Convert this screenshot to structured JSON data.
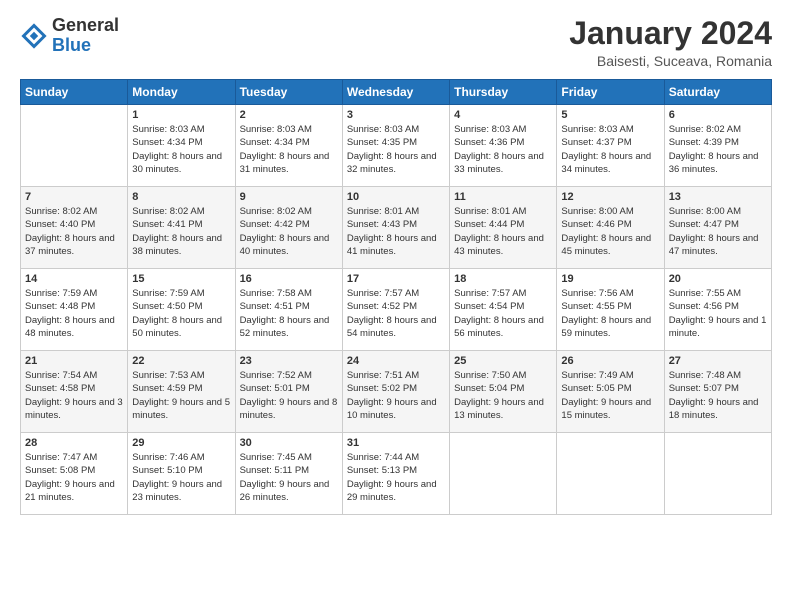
{
  "header": {
    "logo_general": "General",
    "logo_blue": "Blue",
    "month_title": "January 2024",
    "subtitle": "Baisesti, Suceava, Romania"
  },
  "weekdays": [
    "Sunday",
    "Monday",
    "Tuesday",
    "Wednesday",
    "Thursday",
    "Friday",
    "Saturday"
  ],
  "weeks": [
    [
      {
        "day": "",
        "sunrise": "",
        "sunset": "",
        "daylight": "",
        "empty": true
      },
      {
        "day": "1",
        "sunrise": "Sunrise: 8:03 AM",
        "sunset": "Sunset: 4:34 PM",
        "daylight": "Daylight: 8 hours and 30 minutes."
      },
      {
        "day": "2",
        "sunrise": "Sunrise: 8:03 AM",
        "sunset": "Sunset: 4:34 PM",
        "daylight": "Daylight: 8 hours and 31 minutes."
      },
      {
        "day": "3",
        "sunrise": "Sunrise: 8:03 AM",
        "sunset": "Sunset: 4:35 PM",
        "daylight": "Daylight: 8 hours and 32 minutes."
      },
      {
        "day": "4",
        "sunrise": "Sunrise: 8:03 AM",
        "sunset": "Sunset: 4:36 PM",
        "daylight": "Daylight: 8 hours and 33 minutes."
      },
      {
        "day": "5",
        "sunrise": "Sunrise: 8:03 AM",
        "sunset": "Sunset: 4:37 PM",
        "daylight": "Daylight: 8 hours and 34 minutes."
      },
      {
        "day": "6",
        "sunrise": "Sunrise: 8:02 AM",
        "sunset": "Sunset: 4:39 PM",
        "daylight": "Daylight: 8 hours and 36 minutes."
      }
    ],
    [
      {
        "day": "7",
        "sunrise": "Sunrise: 8:02 AM",
        "sunset": "Sunset: 4:40 PM",
        "daylight": "Daylight: 8 hours and 37 minutes."
      },
      {
        "day": "8",
        "sunrise": "Sunrise: 8:02 AM",
        "sunset": "Sunset: 4:41 PM",
        "daylight": "Daylight: 8 hours and 38 minutes."
      },
      {
        "day": "9",
        "sunrise": "Sunrise: 8:02 AM",
        "sunset": "Sunset: 4:42 PM",
        "daylight": "Daylight: 8 hours and 40 minutes."
      },
      {
        "day": "10",
        "sunrise": "Sunrise: 8:01 AM",
        "sunset": "Sunset: 4:43 PM",
        "daylight": "Daylight: 8 hours and 41 minutes."
      },
      {
        "day": "11",
        "sunrise": "Sunrise: 8:01 AM",
        "sunset": "Sunset: 4:44 PM",
        "daylight": "Daylight: 8 hours and 43 minutes."
      },
      {
        "day": "12",
        "sunrise": "Sunrise: 8:00 AM",
        "sunset": "Sunset: 4:46 PM",
        "daylight": "Daylight: 8 hours and 45 minutes."
      },
      {
        "day": "13",
        "sunrise": "Sunrise: 8:00 AM",
        "sunset": "Sunset: 4:47 PM",
        "daylight": "Daylight: 8 hours and 47 minutes."
      }
    ],
    [
      {
        "day": "14",
        "sunrise": "Sunrise: 7:59 AM",
        "sunset": "Sunset: 4:48 PM",
        "daylight": "Daylight: 8 hours and 48 minutes."
      },
      {
        "day": "15",
        "sunrise": "Sunrise: 7:59 AM",
        "sunset": "Sunset: 4:50 PM",
        "daylight": "Daylight: 8 hours and 50 minutes."
      },
      {
        "day": "16",
        "sunrise": "Sunrise: 7:58 AM",
        "sunset": "Sunset: 4:51 PM",
        "daylight": "Daylight: 8 hours and 52 minutes."
      },
      {
        "day": "17",
        "sunrise": "Sunrise: 7:57 AM",
        "sunset": "Sunset: 4:52 PM",
        "daylight": "Daylight: 8 hours and 54 minutes."
      },
      {
        "day": "18",
        "sunrise": "Sunrise: 7:57 AM",
        "sunset": "Sunset: 4:54 PM",
        "daylight": "Daylight: 8 hours and 56 minutes."
      },
      {
        "day": "19",
        "sunrise": "Sunrise: 7:56 AM",
        "sunset": "Sunset: 4:55 PM",
        "daylight": "Daylight: 8 hours and 59 minutes."
      },
      {
        "day": "20",
        "sunrise": "Sunrise: 7:55 AM",
        "sunset": "Sunset: 4:56 PM",
        "daylight": "Daylight: 9 hours and 1 minute."
      }
    ],
    [
      {
        "day": "21",
        "sunrise": "Sunrise: 7:54 AM",
        "sunset": "Sunset: 4:58 PM",
        "daylight": "Daylight: 9 hours and 3 minutes."
      },
      {
        "day": "22",
        "sunrise": "Sunrise: 7:53 AM",
        "sunset": "Sunset: 4:59 PM",
        "daylight": "Daylight: 9 hours and 5 minutes."
      },
      {
        "day": "23",
        "sunrise": "Sunrise: 7:52 AM",
        "sunset": "Sunset: 5:01 PM",
        "daylight": "Daylight: 9 hours and 8 minutes."
      },
      {
        "day": "24",
        "sunrise": "Sunrise: 7:51 AM",
        "sunset": "Sunset: 5:02 PM",
        "daylight": "Daylight: 9 hours and 10 minutes."
      },
      {
        "day": "25",
        "sunrise": "Sunrise: 7:50 AM",
        "sunset": "Sunset: 5:04 PM",
        "daylight": "Daylight: 9 hours and 13 minutes."
      },
      {
        "day": "26",
        "sunrise": "Sunrise: 7:49 AM",
        "sunset": "Sunset: 5:05 PM",
        "daylight": "Daylight: 9 hours and 15 minutes."
      },
      {
        "day": "27",
        "sunrise": "Sunrise: 7:48 AM",
        "sunset": "Sunset: 5:07 PM",
        "daylight": "Daylight: 9 hours and 18 minutes."
      }
    ],
    [
      {
        "day": "28",
        "sunrise": "Sunrise: 7:47 AM",
        "sunset": "Sunset: 5:08 PM",
        "daylight": "Daylight: 9 hours and 21 minutes."
      },
      {
        "day": "29",
        "sunrise": "Sunrise: 7:46 AM",
        "sunset": "Sunset: 5:10 PM",
        "daylight": "Daylight: 9 hours and 23 minutes."
      },
      {
        "day": "30",
        "sunrise": "Sunrise: 7:45 AM",
        "sunset": "Sunset: 5:11 PM",
        "daylight": "Daylight: 9 hours and 26 minutes."
      },
      {
        "day": "31",
        "sunrise": "Sunrise: 7:44 AM",
        "sunset": "Sunset: 5:13 PM",
        "daylight": "Daylight: 9 hours and 29 minutes."
      },
      {
        "day": "",
        "sunrise": "",
        "sunset": "",
        "daylight": "",
        "empty": true
      },
      {
        "day": "",
        "sunrise": "",
        "sunset": "",
        "daylight": "",
        "empty": true
      },
      {
        "day": "",
        "sunrise": "",
        "sunset": "",
        "daylight": "",
        "empty": true
      }
    ]
  ]
}
